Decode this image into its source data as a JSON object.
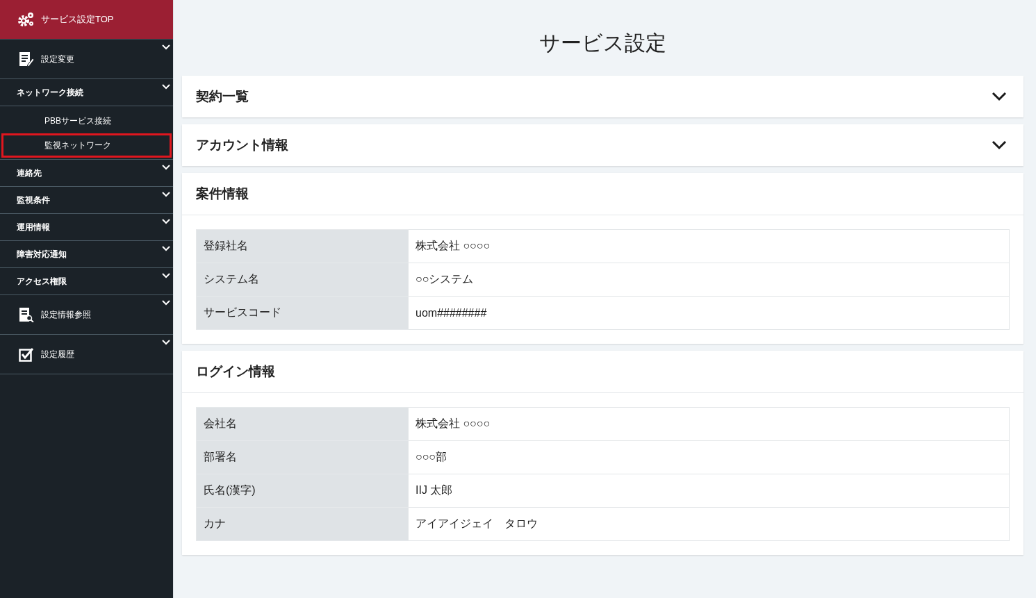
{
  "sidebar": {
    "top": {
      "label": "サービス設定TOP"
    },
    "items": [
      {
        "label": "設定変更",
        "kind": "edit"
      },
      {
        "label": "ネットワーク接続",
        "kind": "text",
        "children": [
          {
            "label": "PBBサービス接続",
            "selected": false
          },
          {
            "label": "監視ネットワーク",
            "selected": true
          }
        ]
      },
      {
        "label": "連絡先",
        "kind": "text"
      },
      {
        "label": "監視条件",
        "kind": "text"
      },
      {
        "label": "運用情報",
        "kind": "text"
      },
      {
        "label": "障害対応通知",
        "kind": "text"
      },
      {
        "label": "アクセス権限",
        "kind": "text"
      },
      {
        "label": "設定情報参照",
        "kind": "browse"
      },
      {
        "label": "設定履歴",
        "kind": "history"
      }
    ]
  },
  "page_title": "サービス設定",
  "sections": [
    {
      "title": "契約一覧",
      "expanded": false
    },
    {
      "title": "アカウント情報",
      "expanded": false
    },
    {
      "title": "案件情報",
      "expanded": true,
      "rows": [
        {
          "label": "登録社名",
          "value": "株式会社 ○○○○"
        },
        {
          "label": "システム名",
          "value": "○○システム"
        },
        {
          "label": "サービスコード",
          "value": "uom########"
        }
      ]
    },
    {
      "title": "ログイン情報",
      "expanded": true,
      "rows": [
        {
          "label": "会社名",
          "value": "株式会社 ○○○○"
        },
        {
          "label": "部署名",
          "value": "○○○部"
        },
        {
          "label": "氏名(漢字)",
          "value": "IIJ 太郎"
        },
        {
          "label": "カナ",
          "value": "アイアイジェイ　タロウ"
        }
      ]
    }
  ]
}
